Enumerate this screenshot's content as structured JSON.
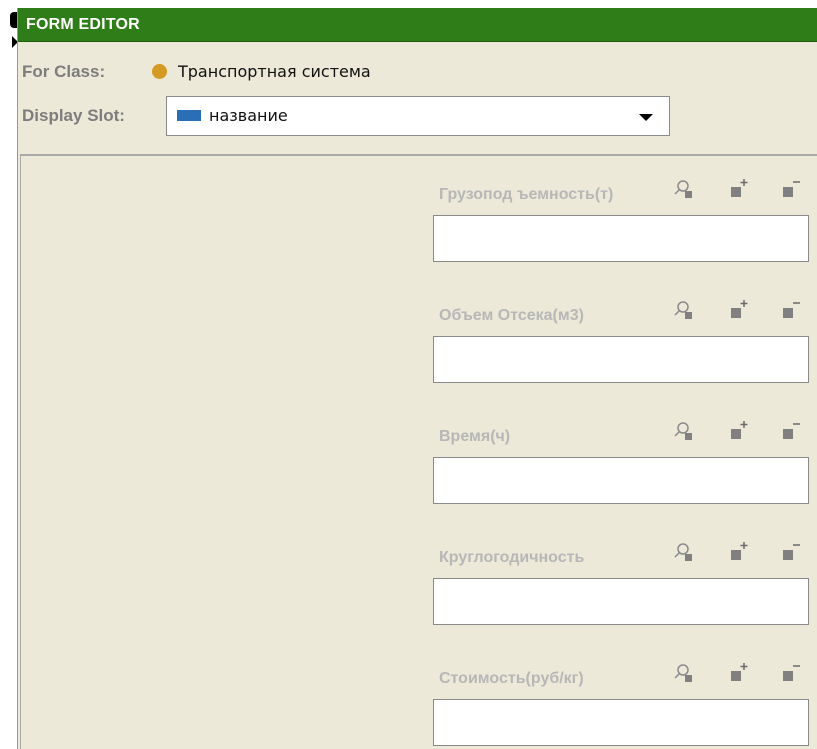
{
  "window": {
    "title": "FORM EDITOR"
  },
  "class_row": {
    "label": "For Class:",
    "value": "Транспортная система",
    "dot_color": "#d49a23"
  },
  "slot_row": {
    "label": "Display Slot:",
    "value": "название",
    "swatch_color": "#2a6fb5"
  },
  "fields": [
    {
      "label": "Грузопод ъемность(т)",
      "value": ""
    },
    {
      "label": "Объем Отсека(м3)",
      "value": ""
    },
    {
      "label": "Время(ч)",
      "value": ""
    },
    {
      "label": "Круглогодичность",
      "value": ""
    },
    {
      "label": "Стоимость(руб/кг)",
      "value": ""
    }
  ],
  "field_icons": [
    "find-value-icon",
    "add-value-icon",
    "remove-value-icon"
  ]
}
